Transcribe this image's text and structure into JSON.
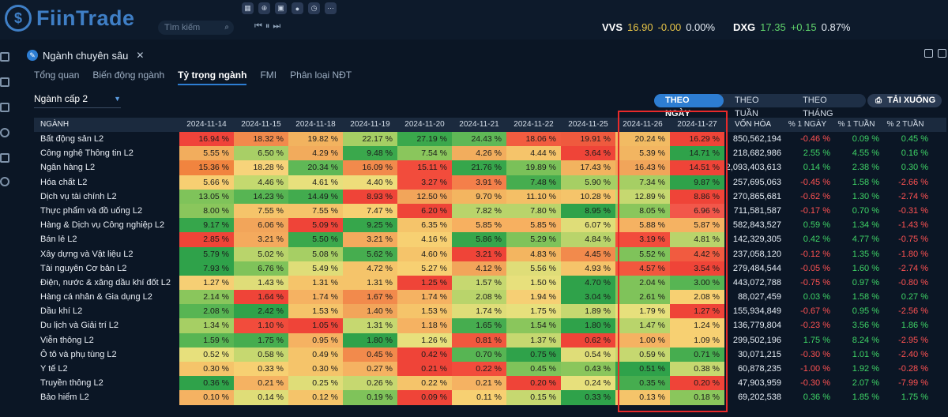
{
  "app": {
    "logo_text": "FiinTrade",
    "search_placeholder": "Tìm kiếm"
  },
  "tickers": [
    {
      "symbol": "VVS",
      "price": "16.90",
      "change": "-0.00",
      "pct": "0.00%",
      "price_color": "#e8c547"
    },
    {
      "symbol": "DXG",
      "price": "17.35",
      "change": "+0.15",
      "pct": "0.87%",
      "price_color": "#5fd26b"
    }
  ],
  "panel": {
    "title": "Ngành chuyên sâu",
    "tabs": [
      "Tổng quan",
      "Biến động ngành",
      "Tỷ trọng ngành",
      "FMI",
      "Phân loại NĐT"
    ],
    "active_tab": "Tỷ trọng ngành",
    "level_select": "Ngành cấp 2",
    "period_toggles": [
      "THEO NGÀY",
      "THEO TUẦN",
      "THEO THÁNG"
    ],
    "active_toggle": "THEO NGÀY",
    "download_label": "TẢI XUỐNG"
  },
  "table": {
    "headers": {
      "name": "NGÀNH",
      "dates": [
        "2024-11-14",
        "2024-11-15",
        "2024-11-18",
        "2024-11-19",
        "2024-11-20",
        "2024-11-21",
        "2024-11-22",
        "2024-11-25",
        "2024-11-26",
        "2024-11-27"
      ],
      "volume": "VỐN HÓA",
      "chg1d": "% 1 NGÀY",
      "chg1w": "% 1 TUẦN",
      "chg2w": "% 2 TUẦN"
    },
    "rows": [
      {
        "name": "Bất động sản L2",
        "values": [
          "16.94 %",
          "18.32 %",
          "19.82 %",
          "22.17 %",
          "27.19 %",
          "24.43 %",
          "18.06 %",
          "19.91 %",
          "20.24 %",
          "16.29 %"
        ],
        "colors": [
          "#f0433a",
          "#f28a4c",
          "#f2b35f",
          "#a6cf64",
          "#3aa84c",
          "#5fb856",
          "#f25c40",
          "#ef5a3e",
          "#f2bb63",
          "#ef4438"
        ],
        "volume": "850,562,194",
        "chg1d": "-0.46 %",
        "chg1w": "0.09 %",
        "chg2w": "0.45 %"
      },
      {
        "name": "Công nghệ Thông tin L2",
        "values": [
          "5.55 %",
          "6.50 %",
          "4.29 %",
          "9.48 %",
          "7.54 %",
          "4.26 %",
          "4.44 %",
          "3.64 %",
          "5.39 %",
          "14.71 %"
        ],
        "colors": [
          "#f2ad5d",
          "#a8cf66",
          "#f2ab5c",
          "#3aa84c",
          "#8ac65c",
          "#f2ad5d",
          "#f5c46a",
          "#ef4438",
          "#f2b561",
          "#2fa24a"
        ],
        "volume": "218,682,986",
        "chg1d": "2.55 %",
        "chg1w": "4.55 %",
        "chg2w": "0.16 %"
      },
      {
        "name": "Ngân hàng L2",
        "values": [
          "15.36 %",
          "18.28 %",
          "20.34 %",
          "16.09 %",
          "15.11 %",
          "21.76 %",
          "19.89 %",
          "17.43 %",
          "16.43 %",
          "14.51 %"
        ],
        "colors": [
          "#f1843f",
          "#f7d37a",
          "#5fb856",
          "#f28a4c",
          "#f24c3c",
          "#36a64b",
          "#7ac159",
          "#f2b35f",
          "#f1a55a",
          "#ef4438"
        ],
        "volume": "2,093,403,613",
        "chg1d": "0.14 %",
        "chg1w": "2.38 %",
        "chg2w": "0.30 %"
      },
      {
        "name": "Hóa chất L2",
        "values": [
          "5.66 %",
          "4.46 %",
          "4.61 %",
          "4.40 %",
          "3.27 %",
          "3.91 %",
          "7.48 %",
          "5.90 %",
          "7.34 %",
          "9.87 %"
        ],
        "colors": [
          "#f7cf72",
          "#c4d96f",
          "#e7e07c",
          "#eedd7a",
          "#f24c3c",
          "#f47f4a",
          "#46ad4f",
          "#a6cf64",
          "#a6cf64",
          "#2fa24a"
        ],
        "volume": "257,695,063",
        "chg1d": "-0.45 %",
        "chg1w": "1.58 %",
        "chg2w": "-2.66 %"
      },
      {
        "name": "Dịch vụ tài chính L2",
        "values": [
          "13.05 %",
          "14.23 %",
          "14.49 %",
          "8.93 %",
          "12.50 %",
          "9.70 %",
          "11.10 %",
          "10.28 %",
          "12.89 %",
          "8.86 %"
        ],
        "colors": [
          "#7fc35a",
          "#57b553",
          "#42ab4e",
          "#ef4438",
          "#f2a55a",
          "#f3b560",
          "#f4bf66",
          "#f5c46a",
          "#c6d870",
          "#ef4438"
        ],
        "volume": "270,865,681",
        "chg1d": "-0.62 %",
        "chg1w": "1.30 %",
        "chg2w": "-2.74 %"
      },
      {
        "name": "Thực phẩm và đồ uống L2",
        "values": [
          "8.00 %",
          "7.55 %",
          "7.55 %",
          "7.47 %",
          "6.20 %",
          "7.82 %",
          "7.80 %",
          "8.95 %",
          "8.05 %",
          "6.96 %"
        ],
        "colors": [
          "#8ac65c",
          "#f5c46a",
          "#f5c46a",
          "#f7d072",
          "#ef4438",
          "#b9d46b",
          "#b9d46b",
          "#2fa24a",
          "#8ac65c",
          "#f2574a"
        ],
        "volume": "711,581,587",
        "chg1d": "-0.17 %",
        "chg1w": "0.70 %",
        "chg2w": "-0.31 %"
      },
      {
        "name": "Hàng & Dịch vụ Công nghiệp L2",
        "values": [
          "9.17 %",
          "6.06 %",
          "5.09 %",
          "9.25 %",
          "6.35 %",
          "5.85 %",
          "5.85 %",
          "6.07 %",
          "5.88 %",
          "5.87 %"
        ],
        "colors": [
          "#36a64b",
          "#f2a55a",
          "#ef4438",
          "#36a64b",
          "#f5c46a",
          "#f7b060",
          "#f7b060",
          "#dfdd78",
          "#f5b262",
          "#f5b262"
        ],
        "volume": "582,843,527",
        "chg1d": "0.59 %",
        "chg1w": "1.34 %",
        "chg2w": "-1.43 %"
      },
      {
        "name": "Bán lẻ L2",
        "values": [
          "2.85 %",
          "3.21 %",
          "5.50 %",
          "3.21 %",
          "4.16 %",
          "5.86 %",
          "5.29 %",
          "4.84 %",
          "3.19 %",
          "4.81 %"
        ],
        "colors": [
          "#ef4438",
          "#f4aa5d",
          "#3aa84c",
          "#f4aa5d",
          "#f7d072",
          "#36a64b",
          "#7fc35a",
          "#b9d46b",
          "#f24c3c",
          "#b9d46b"
        ],
        "volume": "142,329,305",
        "chg1d": "0.42 %",
        "chg1w": "4.77 %",
        "chg2w": "-0.75 %"
      },
      {
        "name": "Xây dựng và Vật liệu L2",
        "values": [
          "5.79 %",
          "5.02 %",
          "5.08 %",
          "5.62 %",
          "4.60 %",
          "3.21 %",
          "4.83 %",
          "4.45 %",
          "5.52 %",
          "4.42 %"
        ],
        "colors": [
          "#2fa24a",
          "#b9d46b",
          "#a6cf64",
          "#46ad4f",
          "#f5c46a",
          "#ef4438",
          "#f3b560",
          "#f28a4c",
          "#7fc35a",
          "#f15b40"
        ],
        "volume": "237,058,120",
        "chg1d": "-0.12 %",
        "chg1w": "1.35 %",
        "chg2w": "-1.80 %"
      },
      {
        "name": "Tài nguyên Cơ bản L2",
        "values": [
          "7.93 %",
          "6.76 %",
          "5.49 %",
          "4.72 %",
          "5.27 %",
          "4.12 %",
          "5.56 %",
          "4.93 %",
          "4.57 %",
          "3.54 %"
        ],
        "colors": [
          "#2fa24a",
          "#7fc35a",
          "#dfdd78",
          "#f5c46a",
          "#f7d072",
          "#f2a55a",
          "#dfdd78",
          "#f5c46a",
          "#f2573e",
          "#ef4438"
        ],
        "volume": "279,484,544",
        "chg1d": "-0.05 %",
        "chg1w": "1.60 %",
        "chg2w": "-2.74 %"
      },
      {
        "name": "Điện, nước & xăng dầu khí đốt L2",
        "values": [
          "1.27 %",
          "1.43 %",
          "1.31 %",
          "1.31 %",
          "1.25 %",
          "1.57 %",
          "1.50 %",
          "4.70 %",
          "2.04 %",
          "3.00 %"
        ],
        "colors": [
          "#f6cf74",
          "#dfdd78",
          "#f5c46a",
          "#f5c46a",
          "#ef4438",
          "#c6d870",
          "#e7e07c",
          "#2fa24a",
          "#7fc35a",
          "#57b553"
        ],
        "volume": "443,072,788",
        "chg1d": "-0.75 %",
        "chg1w": "0.97 %",
        "chg2w": "-0.80 %"
      },
      {
        "name": "Hàng cá nhân & Gia dụng L2",
        "values": [
          "2.14 %",
          "1.64 %",
          "1.74 %",
          "1.67 %",
          "1.74 %",
          "2.08 %",
          "1.94 %",
          "3.04 %",
          "2.61 %",
          "2.08 %"
        ],
        "colors": [
          "#8ac65c",
          "#ef4438",
          "#f5b262",
          "#f28a4c",
          "#f5b262",
          "#b9d46b",
          "#f6cf74",
          "#2fa24a",
          "#7fc35a",
          "#f7d072"
        ],
        "volume": "88,027,459",
        "chg1d": "0.03 %",
        "chg1w": "1.58 %",
        "chg2w": "0.27 %"
      },
      {
        "name": "Dầu khí L2",
        "values": [
          "2.08 %",
          "2.42 %",
          "1.53 %",
          "1.40 %",
          "1.53 %",
          "1.74 %",
          "1.75 %",
          "1.89 %",
          "1.79 %",
          "1.27 %"
        ],
        "colors": [
          "#57b553",
          "#2fa24a",
          "#f5c46a",
          "#f2a55a",
          "#f5c46a",
          "#dfdd78",
          "#e7e07c",
          "#c6d870",
          "#e7e07c",
          "#ef4438"
        ],
        "volume": "155,934,849",
        "chg1d": "-0.67 %",
        "chg1w": "0.95 %",
        "chg2w": "-2.56 %"
      },
      {
        "name": "Du lịch và Giải trí L2",
        "values": [
          "1.34 %",
          "1.10 %",
          "1.05 %",
          "1.31 %",
          "1.18 %",
          "1.65 %",
          "1.54 %",
          "1.80 %",
          "1.47 %",
          "1.24 %"
        ],
        "colors": [
          "#a6cf64",
          "#f24c3c",
          "#ef4438",
          "#c6d870",
          "#f5b262",
          "#46ad4f",
          "#8ac65c",
          "#2fa24a",
          "#b9d46b",
          "#f7d072"
        ],
        "volume": "136,779,804",
        "chg1d": "-0.23 %",
        "chg1w": "3.56 %",
        "chg2w": "1.86 %"
      },
      {
        "name": "Viễn thông L2",
        "values": [
          "1.59 %",
          "1.75 %",
          "0.95 %",
          "1.80 %",
          "1.26 %",
          "0.81 %",
          "1.37 %",
          "0.62 %",
          "1.00 %",
          "1.09 %"
        ],
        "colors": [
          "#57b553",
          "#46ad4f",
          "#f5b262",
          "#2fa24a",
          "#e7e07c",
          "#f2573e",
          "#c6d870",
          "#ef4438",
          "#f5b262",
          "#f7d072"
        ],
        "volume": "299,502,196",
        "chg1d": "1.75 %",
        "chg1w": "8.24 %",
        "chg2w": "-2.95 %"
      },
      {
        "name": "Ô tô và phụ tùng L2",
        "values": [
          "0.52 %",
          "0.58 %",
          "0.49 %",
          "0.45 %",
          "0.42 %",
          "0.70 %",
          "0.75 %",
          "0.54 %",
          "0.59 %",
          "0.71 %"
        ],
        "colors": [
          "#e7e07c",
          "#c6d870",
          "#f5c46a",
          "#f28a4c",
          "#ef4438",
          "#57b553",
          "#2fa24a",
          "#dfdd78",
          "#c6d870",
          "#46ad4f"
        ],
        "volume": "30,071,215",
        "chg1d": "-0.30 %",
        "chg1w": "1.01 %",
        "chg2w": "-2.40 %"
      },
      {
        "name": "Y tế L2",
        "values": [
          "0.30 %",
          "0.33 %",
          "0.30 %",
          "0.27 %",
          "0.21 %",
          "0.22 %",
          "0.45 %",
          "0.43 %",
          "0.51 %",
          "0.38 %"
        ],
        "colors": [
          "#f5c46a",
          "#f7d072",
          "#f5c46a",
          "#f5b262",
          "#ef4438",
          "#f24c3c",
          "#7fc35a",
          "#8ac65c",
          "#2fa24a",
          "#c6d870"
        ],
        "volume": "60,878,235",
        "chg1d": "-1.00 %",
        "chg1w": "1.92 %",
        "chg2w": "-0.28 %"
      },
      {
        "name": "Truyền thông L2",
        "values": [
          "0.36 %",
          "0.21 %",
          "0.25 %",
          "0.26 %",
          "0.22 %",
          "0.21 %",
          "0.20 %",
          "0.24 %",
          "0.35 %",
          "0.20 %"
        ],
        "colors": [
          "#2fa24a",
          "#f5b262",
          "#dfdd78",
          "#c6d870",
          "#f5c46a",
          "#f5b262",
          "#ef4438",
          "#e7e07c",
          "#46ad4f",
          "#ef4438"
        ],
        "volume": "47,903,959",
        "chg1d": "-0.30 %",
        "chg1w": "2.07 %",
        "chg2w": "-7.99 %"
      },
      {
        "name": "Bảo hiểm L2",
        "values": [
          "0.10 %",
          "0.14 %",
          "0.12 %",
          "0.19 %",
          "0.09 %",
          "0.11 %",
          "0.15 %",
          "0.33 %",
          "0.13 %",
          "0.18 %"
        ],
        "colors": [
          "#f5b262",
          "#dfdd78",
          "#f5c46a",
          "#7fc35a",
          "#ef4438",
          "#f7d072",
          "#c6d870",
          "#2fa24a",
          "#f5c46a",
          "#8ac65c"
        ],
        "volume": "69,202,538",
        "chg1d": "0.36 %",
        "chg1w": "1.85 %",
        "chg2w": "1.75 %"
      }
    ]
  }
}
